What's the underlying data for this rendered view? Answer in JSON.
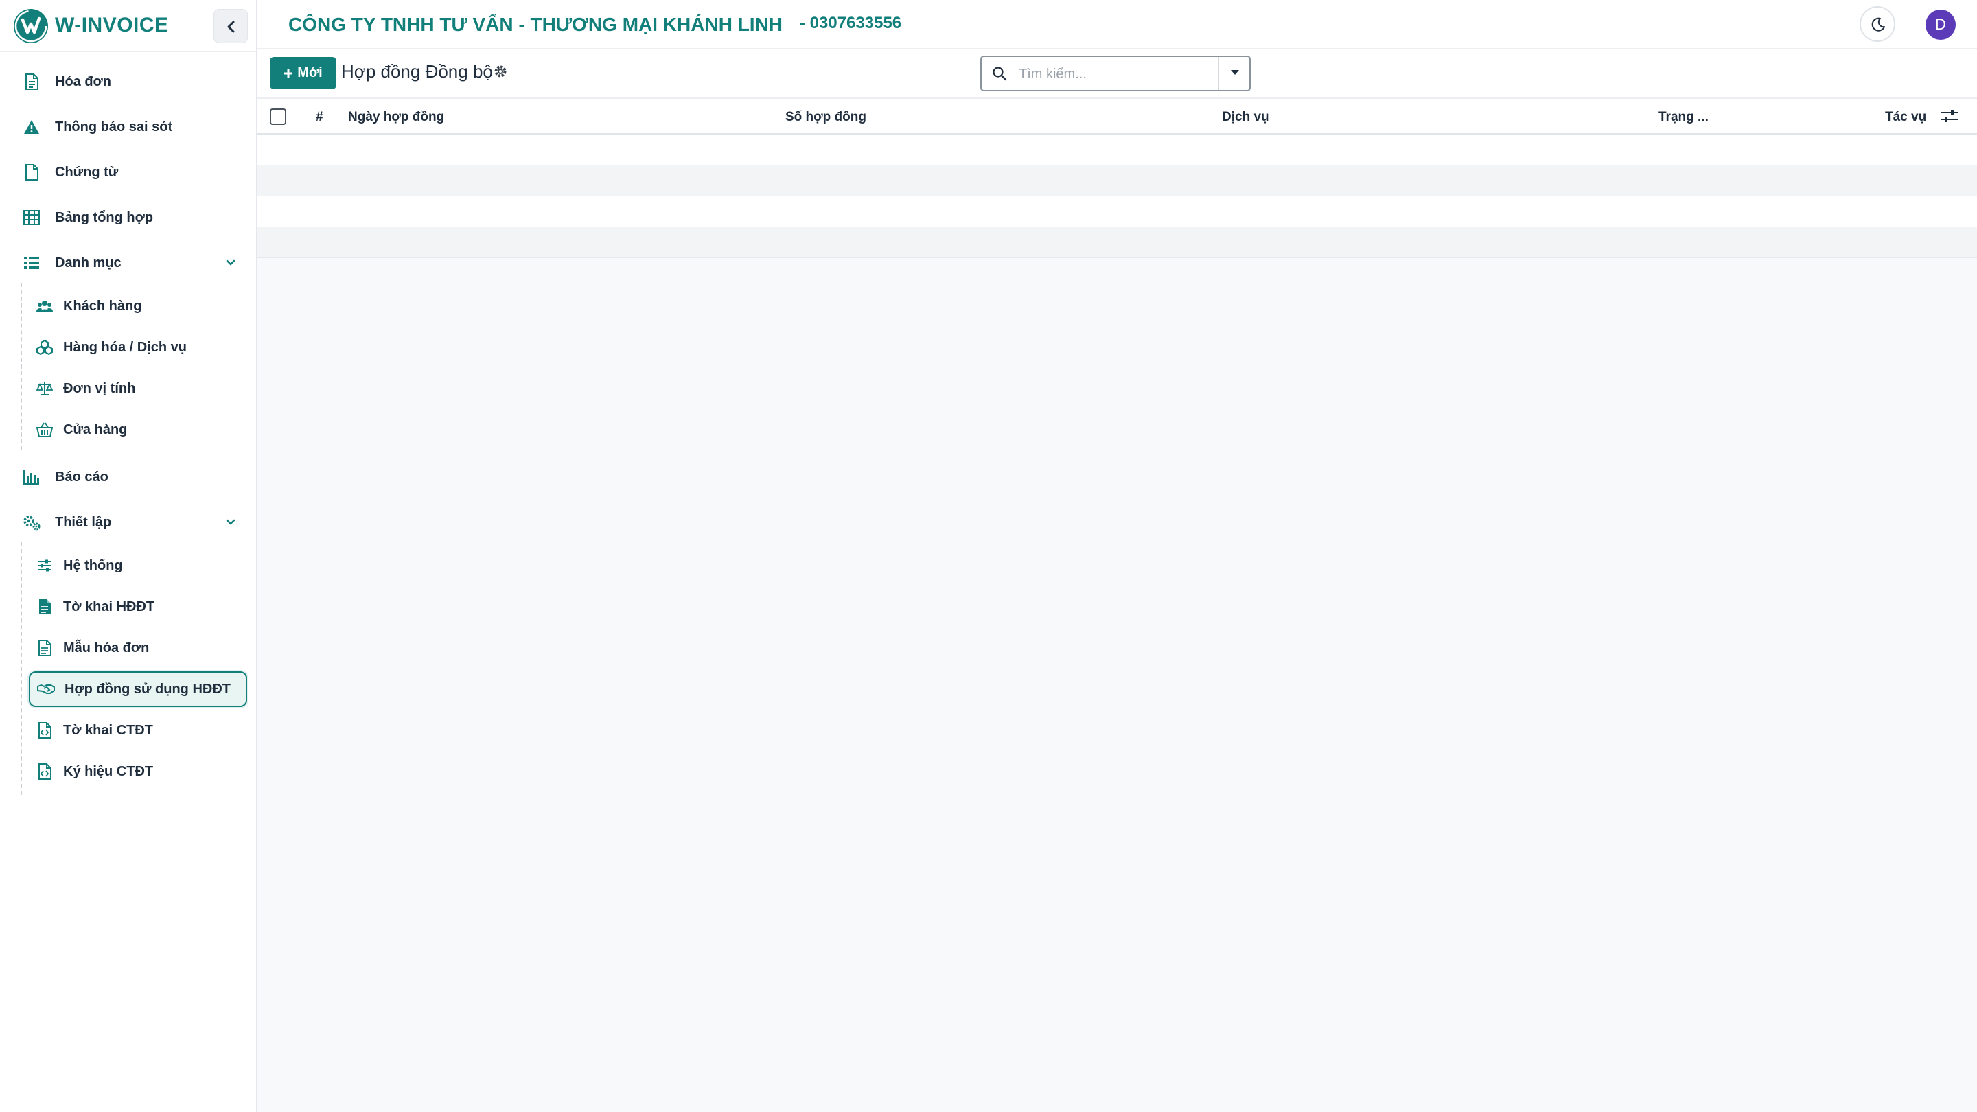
{
  "brand": {
    "name": "W-INVOICE"
  },
  "sidebar": {
    "items": [
      {
        "label": "Hóa đơn",
        "icon": "file-text-icon"
      },
      {
        "label": "Thông báo sai sót",
        "icon": "warning-icon"
      },
      {
        "label": "Chứng từ",
        "icon": "file-icon"
      },
      {
        "label": "Bảng tổng hợp",
        "icon": "table-icon"
      },
      {
        "label": "Danh mục",
        "icon": "list-icon"
      },
      {
        "label": "Báo cáo",
        "icon": "bar-chart-icon"
      },
      {
        "label": "Thiết lập",
        "icon": "cogs-icon"
      }
    ],
    "danh_muc_sub": [
      {
        "label": "Khách hàng",
        "icon": "users-icon"
      },
      {
        "label": "Hàng hóa / Dịch vụ",
        "icon": "cubes-icon"
      },
      {
        "label": "Đơn vị tính",
        "icon": "scale-icon"
      },
      {
        "label": "Cửa hàng",
        "icon": "basket-icon"
      }
    ],
    "thiet_lap_sub": [
      {
        "label": "Hệ thống",
        "icon": "sliders-icon"
      },
      {
        "label": "Tờ khai HĐĐT",
        "icon": "file-solid-icon"
      },
      {
        "label": "Mẫu hóa đơn",
        "icon": "file-lines-icon"
      },
      {
        "label": "Hợp đồng sử dụng HĐĐT",
        "icon": "handshake-icon",
        "active": true
      },
      {
        "label": "Tờ khai CTĐT",
        "icon": "file-code-icon"
      },
      {
        "label": "Ký hiệu CTĐT",
        "icon": "file-code-icon"
      }
    ]
  },
  "header": {
    "company": "CÔNG TY TNHH TƯ VẤN - THƯƠNG MẠI KHÁNH LINH",
    "tax_code": "- 0307633556",
    "avatar_initial": "D"
  },
  "toolbar": {
    "new_label": "Mới",
    "view_title": "Hợp đồng Đồng bộ",
    "search_placeholder": "Tìm kiếm..."
  },
  "table": {
    "columns": [
      "#",
      "Ngày hợp đồng",
      "Số hợp đồng",
      "Dịch vụ",
      "Trạng ...",
      "Tác vụ"
    ],
    "rows": []
  },
  "colors": {
    "brand": "#127f7b",
    "avatar": "#5b3bb8",
    "active_bg": "#e8f5f3"
  }
}
